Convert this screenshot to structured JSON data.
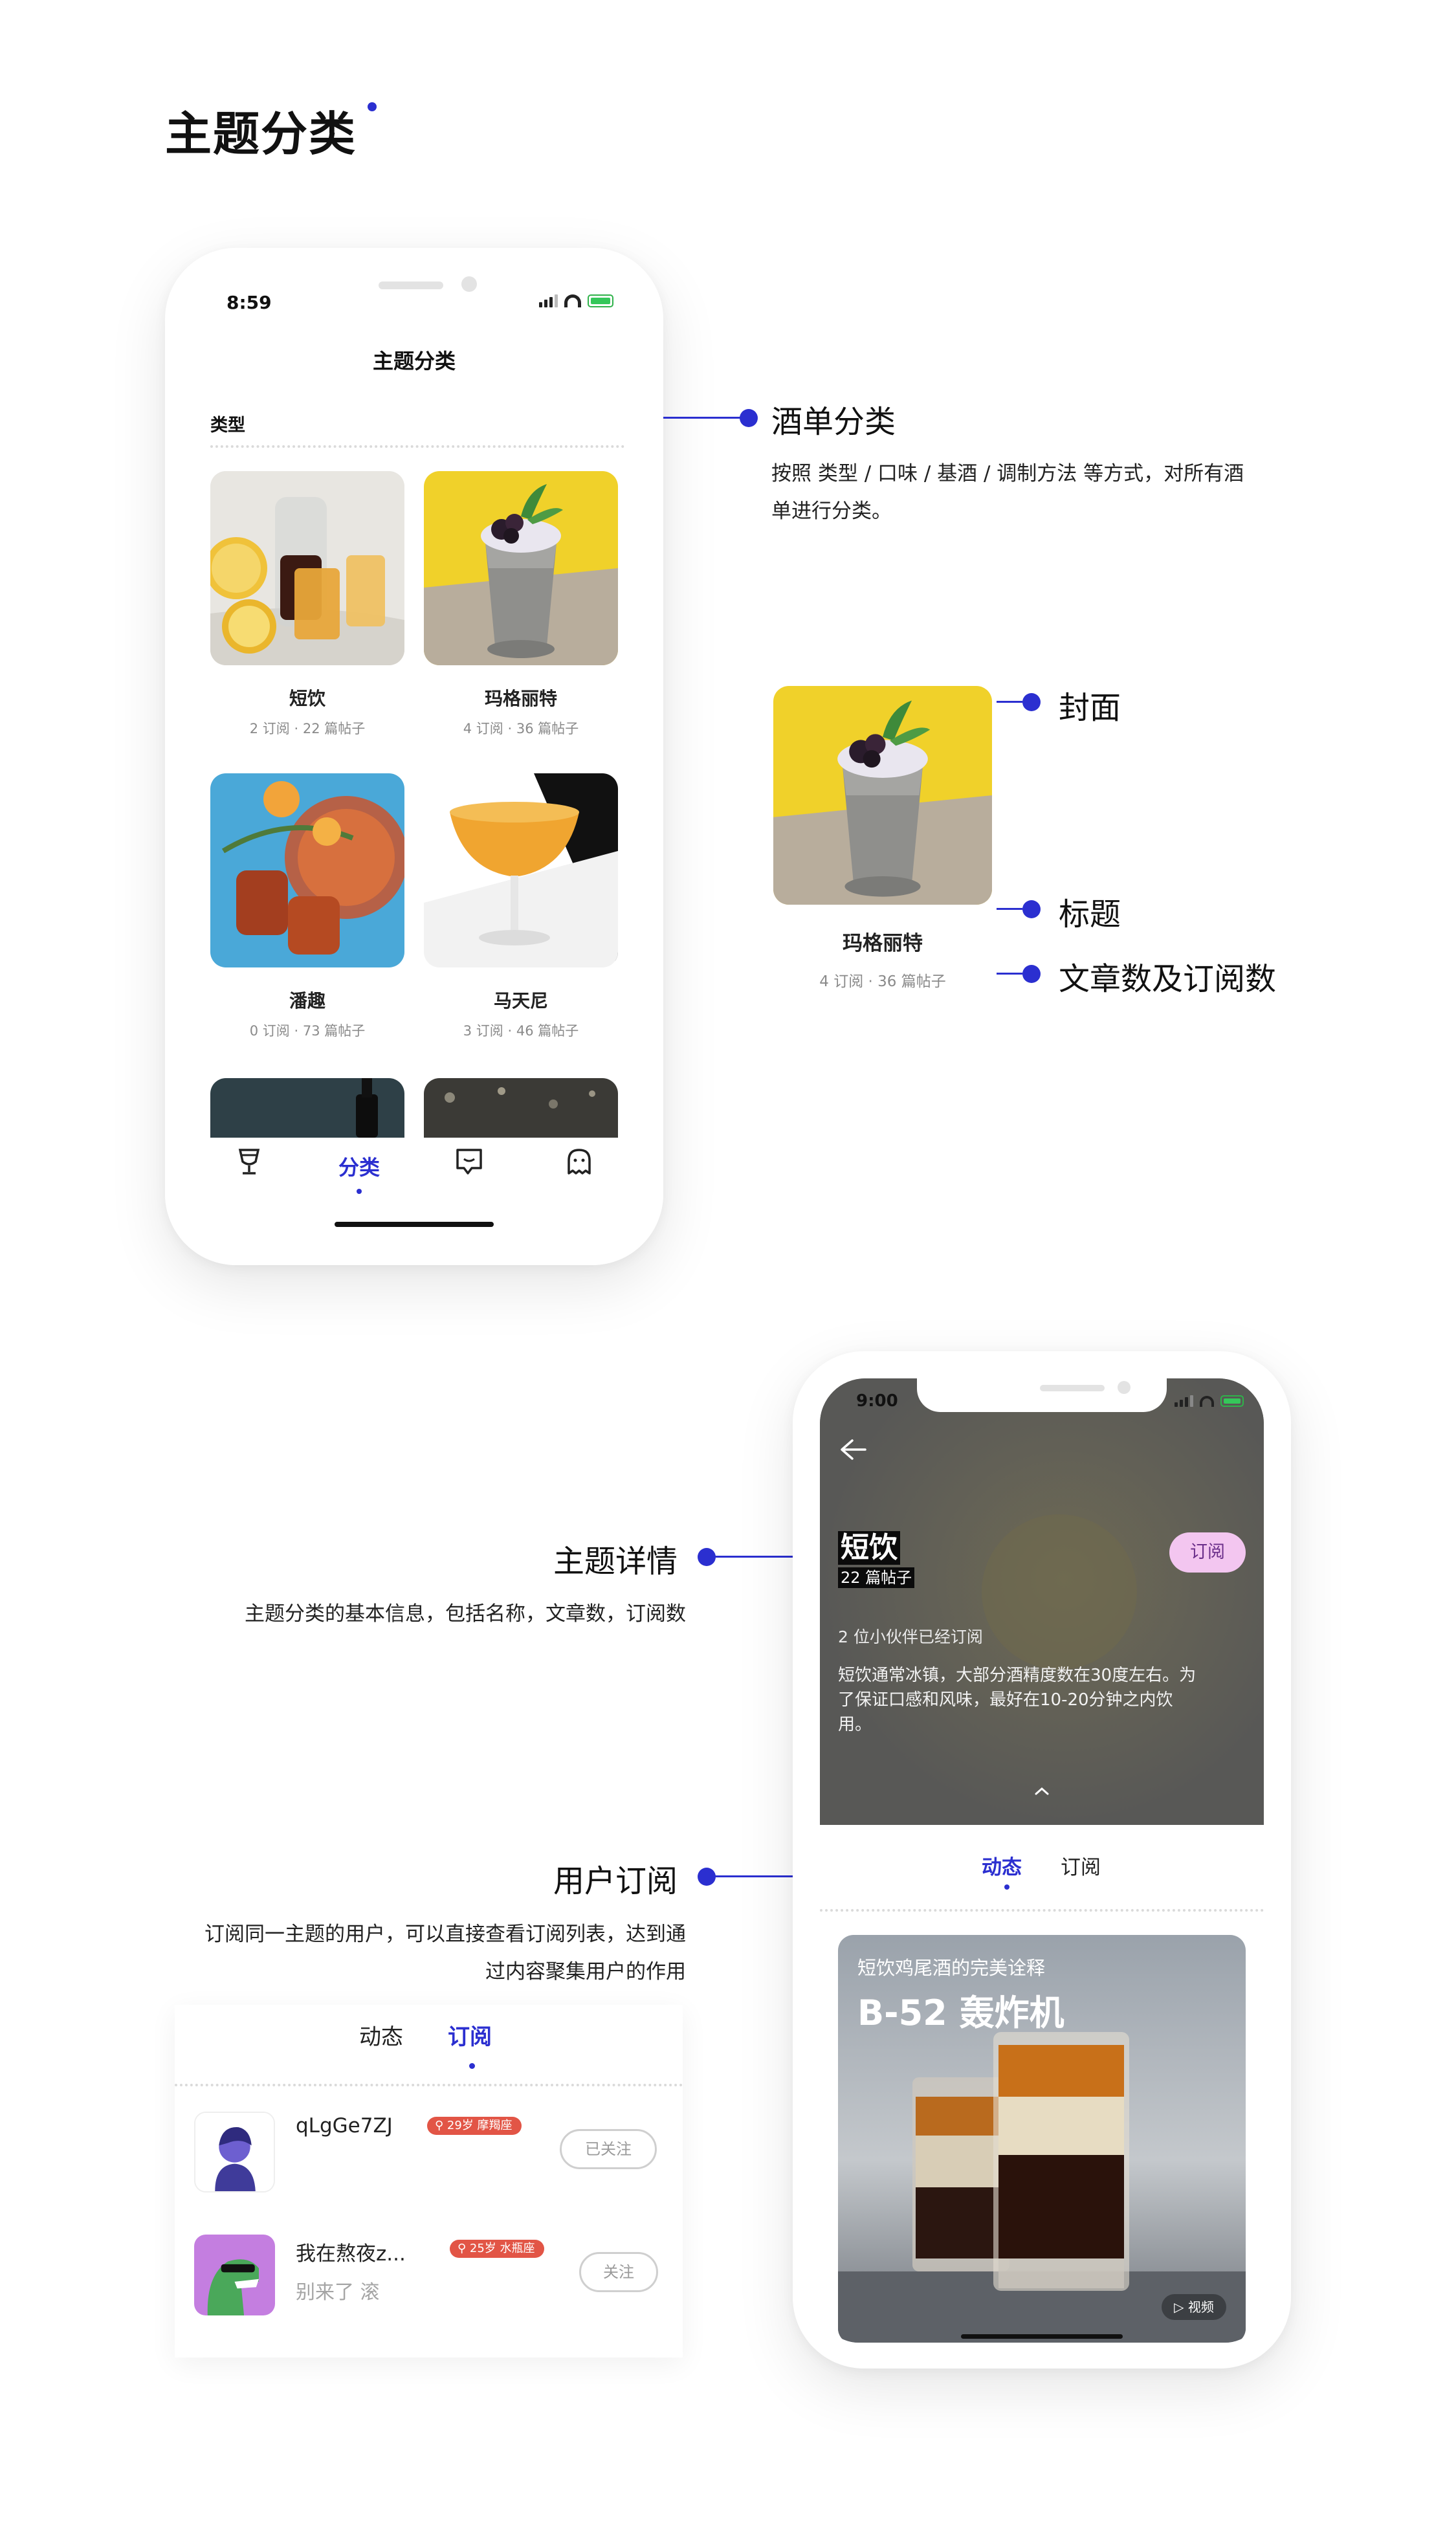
{
  "page": {
    "title": "主题分类",
    "accent": "#2b2fd0"
  },
  "phone_category": {
    "time": "8:59",
    "header_title": "主题分类",
    "section_label": "类型",
    "cards": [
      {
        "title": "短饮",
        "meta": "2 订阅 · 22 篇帖子",
        "image": "citrus-drinks"
      },
      {
        "title": "玛格丽特",
        "meta": "4 订阅 · 36 篇帖子",
        "image": "berry-cup-yellow"
      },
      {
        "title": "潘趣",
        "meta": "0 订阅 · 73 篇帖子",
        "image": "punch-bowl"
      },
      {
        "title": "马天尼",
        "meta": "3 订阅 · 46 篇帖子",
        "image": "martini-glass"
      }
    ],
    "tabs": [
      {
        "icon": "glass-icon",
        "label": ""
      },
      {
        "icon": "",
        "label": "分类"
      },
      {
        "icon": "chat-icon",
        "label": ""
      },
      {
        "icon": "ghost-icon",
        "label": ""
      }
    ]
  },
  "annotations": {
    "menu_category": {
      "title": "酒单分类",
      "desc_line1": "按照 类型 / 口味 / 基酒 / 调制方法 等方式，对所有酒",
      "desc_line2": "单进行分类。"
    },
    "cover": "封面",
    "title_label": "标题",
    "counts_label": "文章数及订阅数",
    "sample_card": {
      "title": "玛格丽特",
      "meta": "4 订阅 · 36 篇帖子"
    },
    "topic_detail": {
      "title": "主题详情",
      "desc": "主题分类的基本信息，包括名称，文章数，订阅数"
    },
    "user_subscribe": {
      "title": "用户订阅",
      "desc_line1": "订阅同一主题的用户，可以直接查看订阅列表，达到通",
      "desc_line2": "过内容聚集用户的作用"
    }
  },
  "phone_detail": {
    "time": "9:00",
    "topic_name": "短饮",
    "post_count": "22 篇帖子",
    "subscribe_button": "订阅",
    "subscribers": "2 位小伙伴已经订阅",
    "desc_line1": "短饮通常冰镇，大部分酒精度数在30度左右。为",
    "desc_line2": "了保证口感和风味，最好在10-20分钟之内饮",
    "desc_line3": "用。",
    "tabs": [
      "动态",
      "订阅"
    ],
    "feed_card": {
      "subtitle": "短饮鸡尾酒的完美诠释",
      "headline": "B-52 轰炸机",
      "video_label": "▷ 视频"
    }
  },
  "subscription_list": {
    "tabs": [
      "动态",
      "订阅"
    ],
    "users": [
      {
        "name": "qLgGe7ZJ",
        "tag": "29岁 摩羯座",
        "bio": "",
        "button": "已关注"
      },
      {
        "name": "我在熬夜z...",
        "tag": "25岁 水瓶座",
        "bio": "别来了 滚",
        "button": "关注"
      }
    ]
  }
}
